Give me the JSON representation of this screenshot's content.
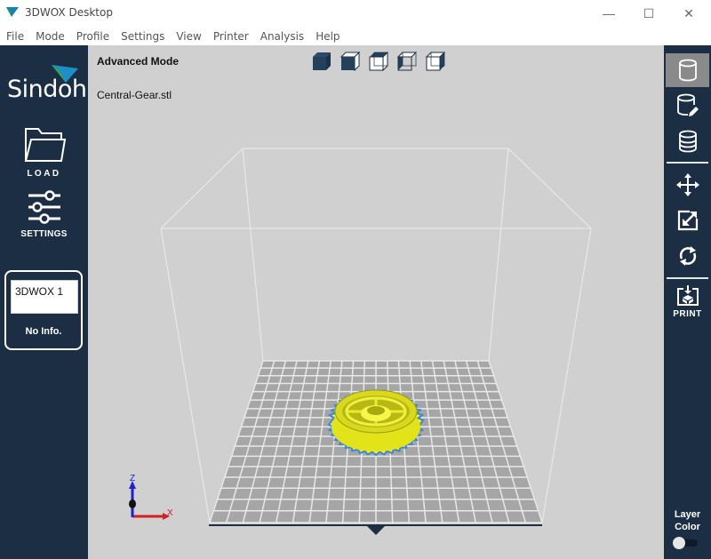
{
  "window": {
    "title": "3DWOX Desktop",
    "controls": {
      "minimize": "—",
      "maximize": "☐",
      "close": "✕"
    }
  },
  "menu": [
    "File",
    "Mode",
    "Profile",
    "Settings",
    "View",
    "Printer",
    "Analysis",
    "Help"
  ],
  "left_panel": {
    "brand": "Sindoh",
    "load_label": "LOAD",
    "settings_label": "SETTINGS",
    "printer": {
      "name": "3DWOX 1",
      "info": "No Info."
    }
  },
  "viewport": {
    "mode": "Advanced Mode",
    "file_name": "Central-Gear.stl",
    "view_cubes": [
      "view-iso",
      "view-front",
      "view-top",
      "view-left",
      "view-right"
    ],
    "axes": {
      "z": "Z",
      "x": "X"
    },
    "colors": {
      "model": "#f2f21a",
      "model_outline": "#3a86d9",
      "bed": "#a6a6a6",
      "grid": "#e8e8e8",
      "accent": "#1c2e44"
    }
  },
  "right_panel": {
    "tools": [
      "load-model-icon",
      "edit-model-icon",
      "layers-icon",
      "move-icon",
      "scale-icon",
      "rotate-icon"
    ],
    "print_label": "PRINT",
    "layer_color_label_1": "Layer",
    "layer_color_label_2": "Color",
    "layer_color_enabled": false
  }
}
